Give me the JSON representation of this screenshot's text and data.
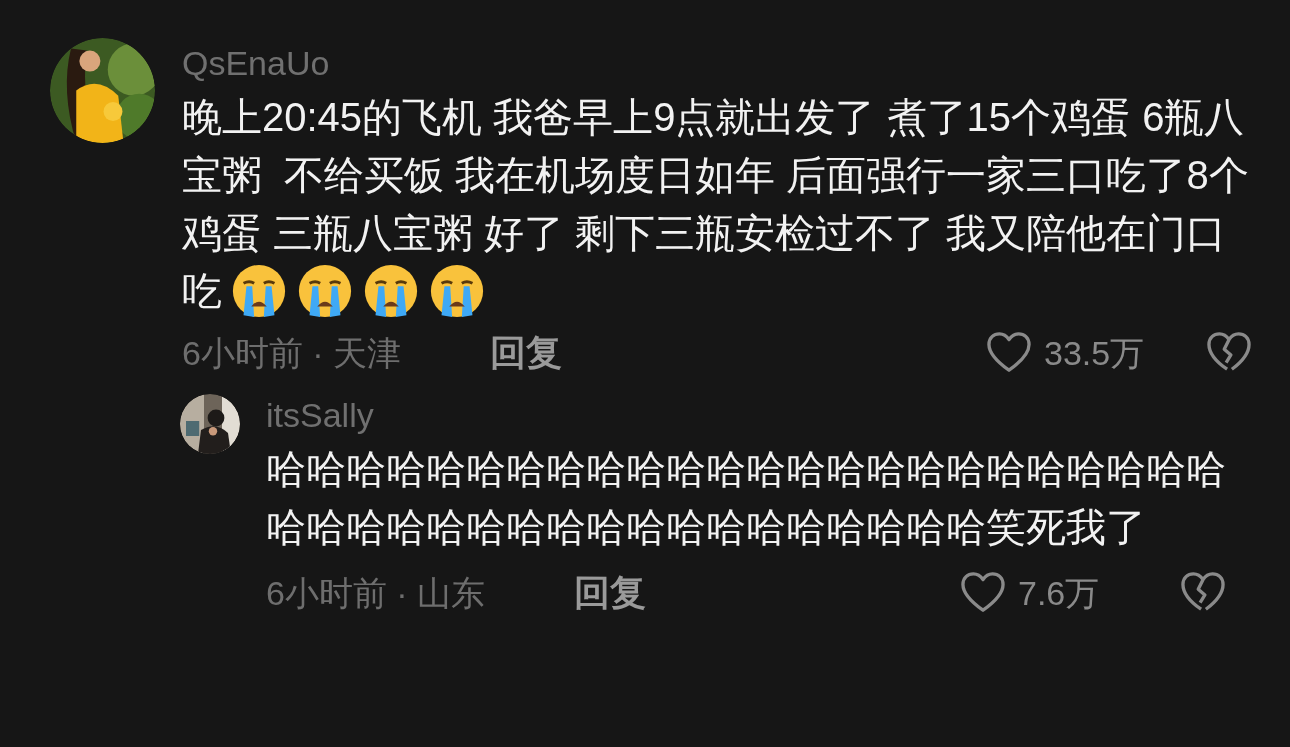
{
  "comments": [
    {
      "username": "QsEnaUo",
      "text": "晚上20:45的飞机 我爸早上9点就出发了 煮了15个鸡蛋 6瓶八宝粥  不给买饭 我在机场度日如年 后面强行一家三口吃了8个鸡蛋 三瓶八宝粥 好了 剩下三瓶安检过不了 我又陪他在门口吃",
      "emojis": [
        {
          "kind": "crying"
        },
        {
          "kind": "crying"
        },
        {
          "kind": "crying"
        },
        {
          "kind": "crying"
        }
      ],
      "time_location": "6小时前 · 天津",
      "reply_label": "回复",
      "likes": "33.5万",
      "replies": [
        {
          "username": "itsSally",
          "text": "哈哈哈哈哈哈哈哈哈哈哈哈哈哈哈哈哈哈哈哈哈哈哈哈哈哈哈哈哈哈哈哈哈哈哈哈哈哈哈哈哈哈笑死我了",
          "time_location": "6小时前 · 山东",
          "reply_label": "回复",
          "likes": "7.6万"
        }
      ]
    }
  ]
}
